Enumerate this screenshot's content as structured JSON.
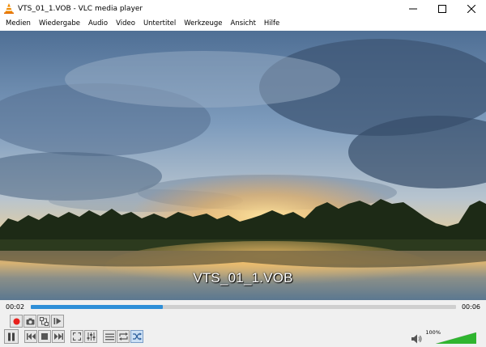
{
  "window": {
    "title": "VTS_01_1.VOB - VLC media player",
    "icon": "vlc-cone-icon",
    "controls": [
      "minimize-icon",
      "maximize-icon",
      "close-icon"
    ]
  },
  "menu": {
    "items": [
      "Medien",
      "Wiedergabe",
      "Audio",
      "Video",
      "Untertitel",
      "Werkzeuge",
      "Ansicht",
      "Hilfe"
    ]
  },
  "video": {
    "subtitle": "VTS_01_1.VOB"
  },
  "seek": {
    "current_time": "00:02",
    "total_time": "00:06",
    "progress": 0.31
  },
  "controls_row1": [
    {
      "name": "record-button",
      "icon": "record-icon"
    },
    {
      "name": "snapshot-button",
      "icon": "camera-icon"
    },
    {
      "name": "loop-ab-button",
      "icon": "loop-ab-icon"
    },
    {
      "name": "frame-step-button",
      "icon": "frame-step-icon"
    }
  ],
  "controls_row2": [
    {
      "name": "pause-button",
      "icon": "pause-icon"
    },
    {
      "name": "previous-button",
      "icon": "skip-back-icon"
    },
    {
      "name": "stop-button",
      "icon": "stop-icon"
    },
    {
      "name": "next-button",
      "icon": "skip-forward-icon"
    },
    {
      "name": "fullscreen-button",
      "icon": "fullscreen-icon"
    },
    {
      "name": "extended-settings-button",
      "icon": "equalizer-icon"
    },
    {
      "name": "playlist-button",
      "icon": "playlist-icon"
    },
    {
      "name": "loop-button",
      "icon": "repeat-icon"
    },
    {
      "name": "shuffle-button",
      "icon": "shuffle-icon"
    }
  ],
  "volume": {
    "label": "100%",
    "level": 1.0,
    "icon": "speaker-icon"
  },
  "colors": {
    "accent": "#2f8fd8",
    "record": "#e8201c",
    "volume": "#2fb52f"
  }
}
